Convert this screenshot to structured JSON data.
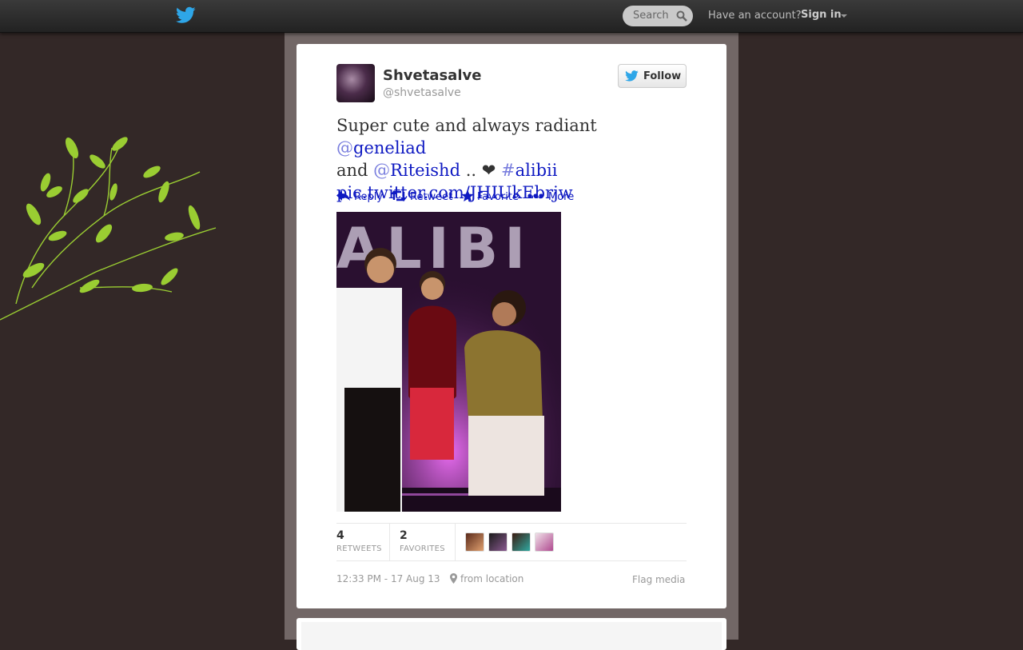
{
  "topbar": {
    "logo_icon": "twitter-bird-icon",
    "search_placeholder": "Search",
    "have_account": "Have an account?",
    "sign_in": "Sign in"
  },
  "tweet": {
    "user": {
      "display_name": "Shvetasalve",
      "screen_name": "@shvetasalve"
    },
    "follow_label": "Follow",
    "text": {
      "part1": "Super cute and always radiant ",
      "mention1_sym": "@",
      "mention1": "geneliad",
      "part2": "and ",
      "mention2_sym": "@",
      "mention2": "Riteishd",
      "part3": " .. ❤ ",
      "hashtag_sym": "#",
      "hashtag": "alibii",
      "link": "pic.twitter.com/JHIUkEbrjw"
    },
    "actions": {
      "reply": "Reply",
      "retweet": "Retweet",
      "favorite": "Favorite",
      "more": "More"
    },
    "photo_sign_text": "ALIBI",
    "stats": {
      "retweets_count": "4",
      "retweets_label": "RETWEETS",
      "favorites_count": "2",
      "favorites_label": "FAVORITES"
    },
    "timestamp": "12:33 PM - 17 Aug 13",
    "location": "from location",
    "flag_media": "Flag media"
  },
  "colors": {
    "link": "#0e19c2",
    "page_bg": "#332827",
    "column_bg": "#726766",
    "leaf": "#9acd32"
  }
}
